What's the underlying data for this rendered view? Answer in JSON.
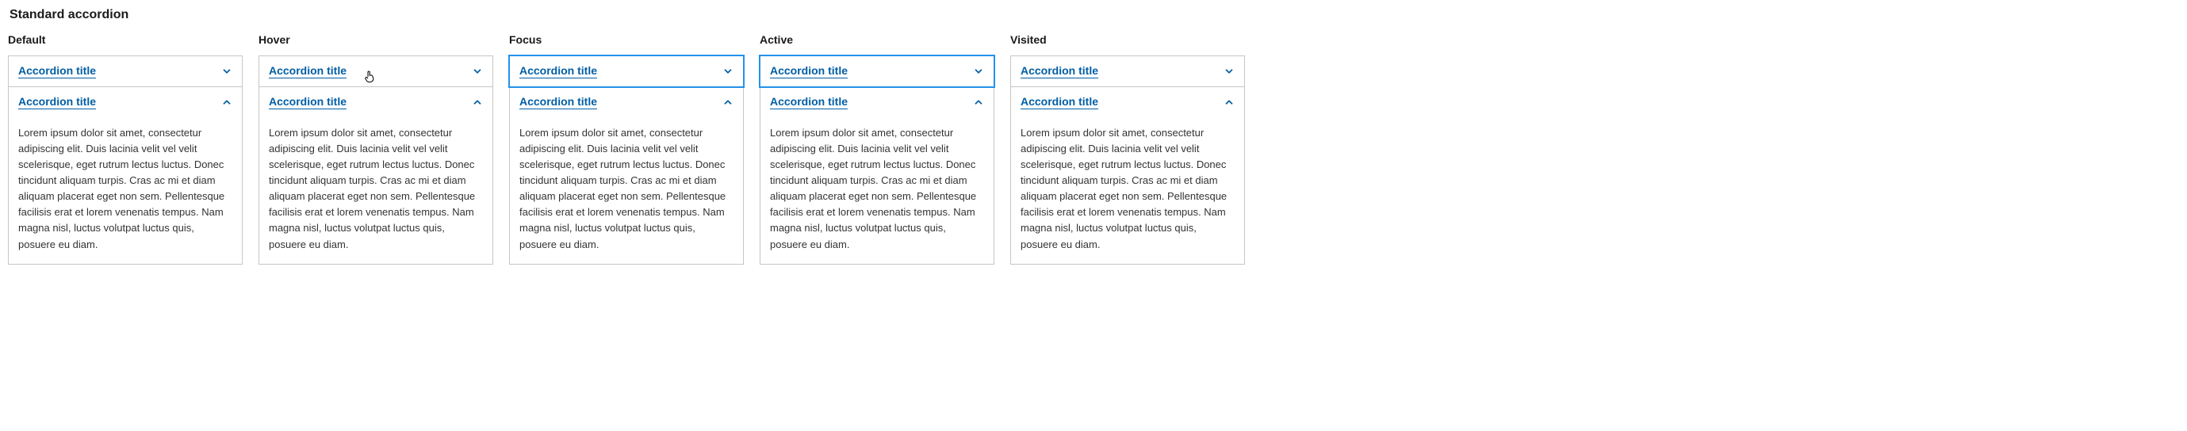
{
  "pageTitle": "Standard accordion",
  "bodyText": "Lorem ipsum dolor sit amet, consectetur adipiscing elit. Duis lacinia velit vel velit scelerisque, eget rutrum lectus luctus. Donec tincidunt aliquam turpis. Cras ac mi et diam aliquam placerat eget non sem. Pellentesque facilisis erat et lorem venenatis tempus. Nam magna nisl, luctus volutpat luctus quis, posuere eu diam.",
  "columns": [
    {
      "label": "Default",
      "first": "Accordion title",
      "second": "Accordion title"
    },
    {
      "label": "Hover",
      "first": "Accordion title",
      "second": "Accordion title"
    },
    {
      "label": "Focus",
      "first": "Accordion title",
      "second": "Accordion title"
    },
    {
      "label": "Active",
      "first": "Accordion title",
      "second": "Accordion title"
    },
    {
      "label": "Visited",
      "first": "Accordion title",
      "second": "Accordion title"
    }
  ]
}
